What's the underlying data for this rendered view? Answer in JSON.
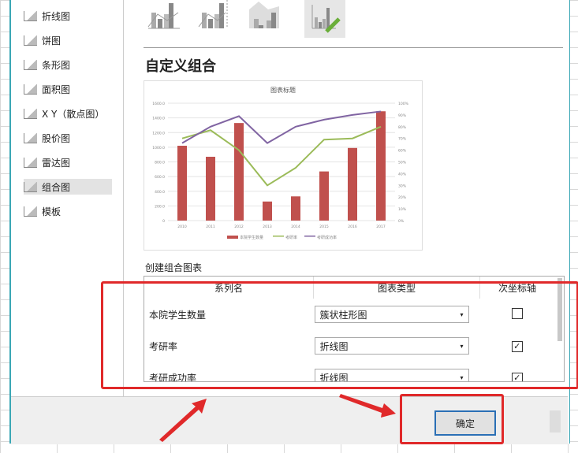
{
  "sidebar": {
    "items": [
      {
        "label": "折线图",
        "icon": "line-chart-icon"
      },
      {
        "label": "饼图",
        "icon": "pie-chart-icon"
      },
      {
        "label": "条形图",
        "icon": "bar-chart-icon"
      },
      {
        "label": "面积图",
        "icon": "area-chart-icon"
      },
      {
        "label": "X Y（散点图）",
        "icon": "scatter-chart-icon"
      },
      {
        "label": "股价图",
        "icon": "stock-chart-icon"
      },
      {
        "label": "雷达图",
        "icon": "radar-chart-icon"
      },
      {
        "label": "组合图",
        "icon": "combo-chart-icon",
        "selected": true
      },
      {
        "label": "模板",
        "icon": "template-icon"
      }
    ]
  },
  "main": {
    "section_title": "自定义组合",
    "create_label": "创建组合图表"
  },
  "table": {
    "headers": [
      "系列名",
      "图表类型",
      "次坐标轴"
    ],
    "rows": [
      {
        "name": "本院学生数量",
        "type": "簇状柱形图",
        "secondary": false
      },
      {
        "name": "考研率",
        "type": "折线图",
        "secondary": true
      },
      {
        "name": "考研成功率",
        "type": "折线图",
        "secondary": true
      }
    ]
  },
  "footer": {
    "ok_label": "确定"
  },
  "colors": {
    "bar": "#c0504d",
    "green": "#9bbb59",
    "purple": "#8064a2",
    "highlight": "#e0292a"
  },
  "chart_data": {
    "type": "bar",
    "title": "图表标题",
    "categories": [
      "2010",
      "2011",
      "2012",
      "2013",
      "2014",
      "2015",
      "2016",
      "2017"
    ],
    "ylim": [
      0,
      1600
    ],
    "yticks": [
      "0",
      "200.0",
      "400.0",
      "600.0",
      "800.0",
      "1000.0",
      "1200.0",
      "1400.0",
      "1600.0"
    ],
    "y2lim": [
      0,
      100
    ],
    "y2ticks": [
      "0%",
      "10%",
      "20%",
      "30%",
      "40%",
      "50%",
      "60%",
      "70%",
      "80%",
      "90%",
      "100%"
    ],
    "series": [
      {
        "name": "本院学生数量",
        "type": "bar",
        "axis": "primary",
        "values": [
          1020,
          870,
          1330,
          260,
          330,
          670,
          990,
          1490
        ]
      },
      {
        "name": "考研率",
        "type": "line",
        "axis": "secondary",
        "values": [
          70,
          77,
          60,
          30,
          45,
          69,
          70,
          80
        ]
      },
      {
        "name": "考研成功率",
        "type": "line",
        "axis": "secondary",
        "values": [
          66,
          80,
          89,
          66,
          80,
          86,
          90,
          93
        ]
      }
    ],
    "legend": "bottom"
  }
}
